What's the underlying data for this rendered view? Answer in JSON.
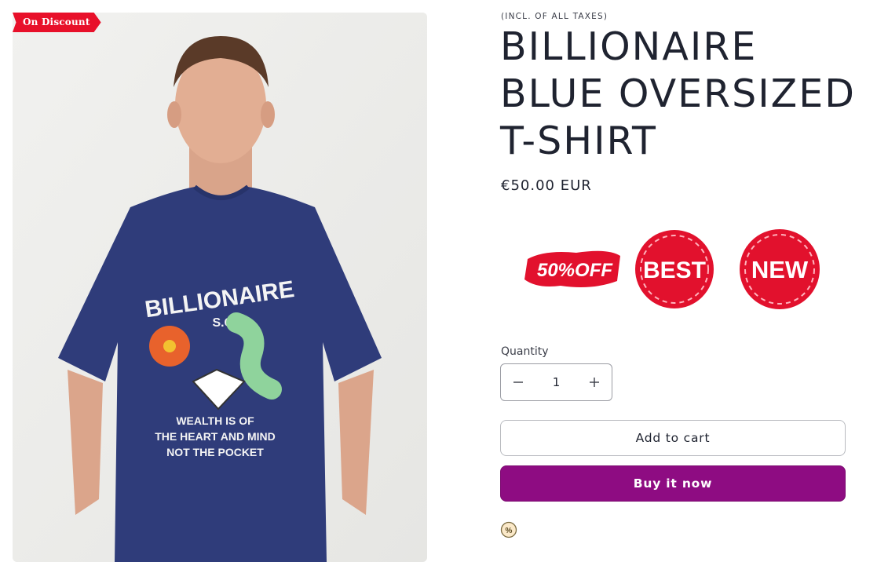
{
  "badge": {
    "discount_label": "On Discount"
  },
  "product": {
    "tax_note": "(INCL. OF ALL TAXES)",
    "title": "BILLIONAIRE BLUE OVERSIZED T-SHIRT",
    "price": "€50.00 EUR"
  },
  "image": {
    "print_lines": [
      "BILLIONAIRE",
      "S.C.",
      "WEALTH IS OF",
      "THE HEART AND MIND",
      "NOT THE POCKET"
    ]
  },
  "stickers": {
    "discount": "50%OFF",
    "best": "BEST",
    "new": "NEW"
  },
  "quantity": {
    "label": "Quantity",
    "value": "1"
  },
  "actions": {
    "add_to_cart": "Add to cart",
    "buy_now": "Buy it now"
  },
  "colors": {
    "accent_buy": "#8e0c82",
    "badge_red": "#e8102a",
    "shirt": "#2f3c7a"
  },
  "icons": {
    "decrease": "minus-icon",
    "increase": "plus-icon",
    "promo": "percent-badge-icon"
  }
}
